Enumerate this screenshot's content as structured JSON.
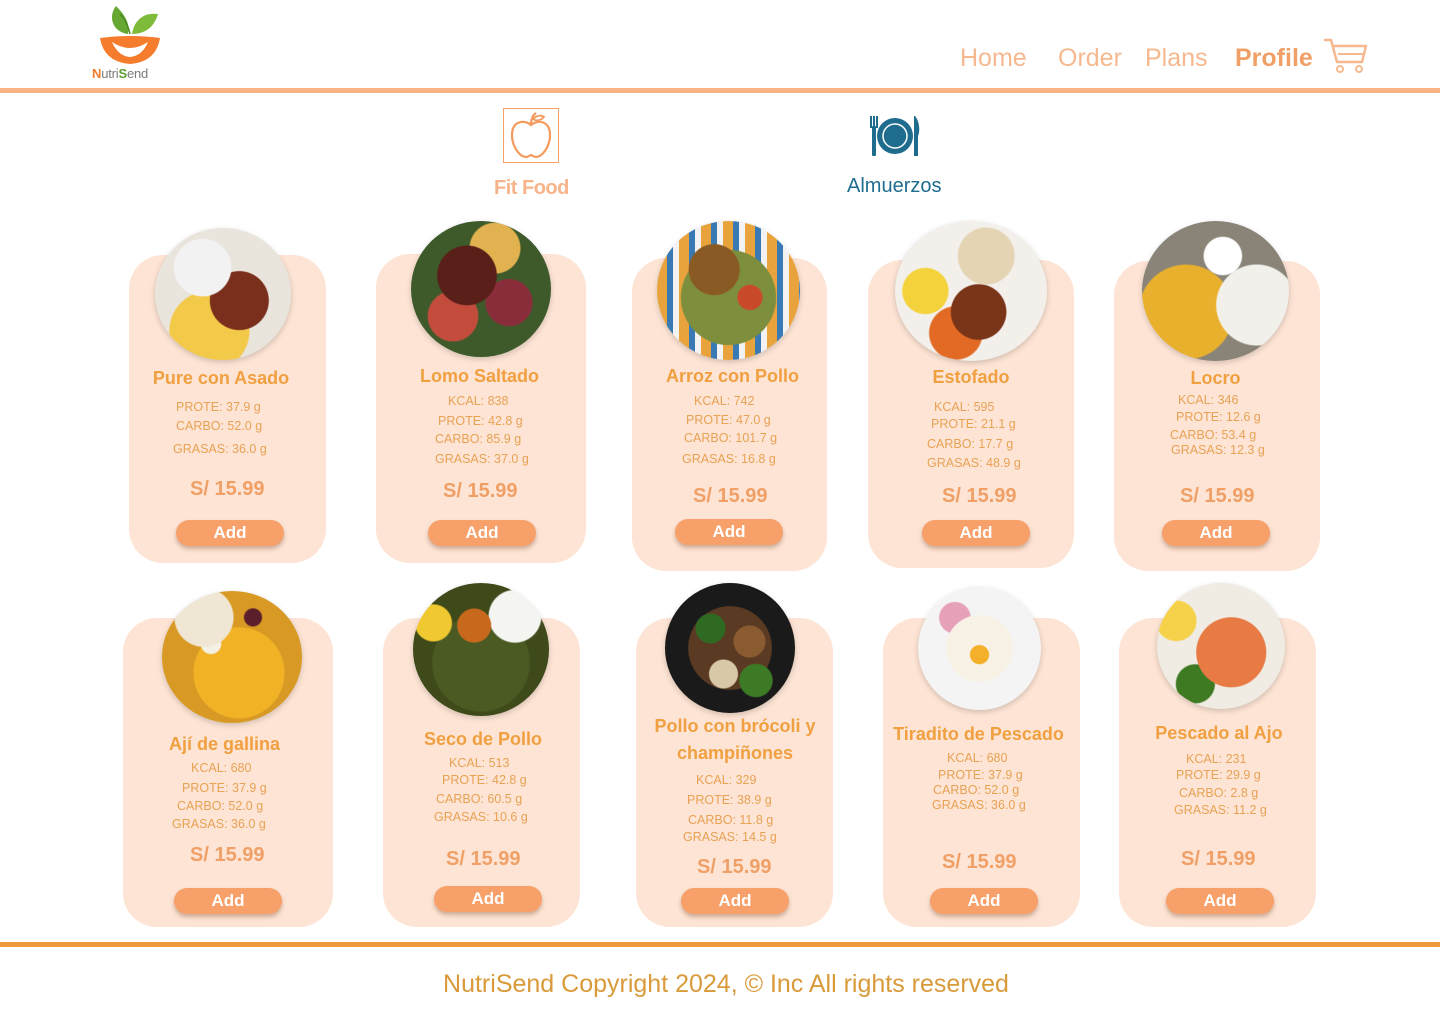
{
  "brand": {
    "name_part1": "N",
    "name_part2": "utri",
    "name_part3": "S",
    "name_part4": "end",
    "accent_color": "#f7a06a",
    "card_color": "#fde4d4"
  },
  "nav": {
    "home": "Home",
    "order": "Order",
    "plans": "Plans",
    "profile": "Profile",
    "cart_icon": "cart-icon"
  },
  "categories": {
    "fit_food": "Fit Food",
    "almuerzos": "Almuerzos"
  },
  "dishes": [
    {
      "name": "Pure con Asado",
      "kcal": "",
      "prote": "PROTE: 37.9 g",
      "carbo": "CARBO: 52.0  g",
      "grasas": "GRASAS: 36.0  g",
      "price": "S/ 15.99",
      "add": "Add"
    },
    {
      "name": "Lomo Saltado",
      "kcal": "KCAL: 838",
      "prote": "PROTE: 42.8 g",
      "carbo": "CARBO: 85.9 g",
      "grasas": "GRASAS: 37.0 g",
      "price": "S/ 15.99",
      "add": "Add"
    },
    {
      "name": "Arroz con Pollo",
      "kcal": "KCAL: 742",
      "prote": "PROTE: 47.0 g",
      "carbo": "CARBO: 101.7 g",
      "grasas": "GRASAS: 16.8 g",
      "price": "S/ 15.99",
      "add": "Add"
    },
    {
      "name": "Estofado",
      "kcal": "KCAL: 595",
      "prote": "PROTE: 21.1  g",
      "carbo": "CARBO: 17.7  g",
      "grasas": "GRASAS: 48.9 g",
      "price": "S/ 15.99",
      "add": "Add"
    },
    {
      "name": "Locro",
      "kcal": "KCAL: 346",
      "prote": "PROTE: 12.6 g",
      "carbo": "CARBO: 53.4 g",
      "grasas": "GRASAS: 12.3 g",
      "price": "S/ 15.99",
      "add": "Add"
    },
    {
      "name": "Ají de gallina",
      "kcal": "KCAL: 680",
      "prote": "PROTE: 37.9 g",
      "carbo": "CARBO: 52.0  g",
      "grasas": "GRASAS: 36.0  g",
      "price": "S/ 15.99",
      "add": "Add"
    },
    {
      "name": "Seco de Pollo",
      "kcal": "KCAL: 513",
      "prote": "PROTE: 42.8 g",
      "carbo": "CARBO: 60.5 g",
      "grasas": "GRASAS: 10.6 g",
      "price": "S/ 15.99",
      "add": "Add"
    },
    {
      "name": "Pollo con brócoli y champiñones",
      "kcal": "KCAL: 329",
      "prote": "PROTE: 38.9 g",
      "carbo": "CARBO: 11.8 g",
      "grasas": "GRASAS: 14.5 g",
      "price": "S/ 15.99",
      "add": "Add"
    },
    {
      "name": "Tiradito de Pescado",
      "kcal": "KCAL: 680",
      "prote": "PROTE: 37.9 g",
      "carbo": "CARBO: 52.0  g",
      "grasas": "GRASAS: 36.0  g",
      "price": "S/ 15.99",
      "add": "Add"
    },
    {
      "name": "Pescado al Ajo",
      "kcal": "KCAL: 231",
      "prote": "PROTE: 29.9 g",
      "carbo": "CARBO: 2.8 g",
      "grasas": "GRASAS: 11.2 g",
      "price": "S/ 15.99",
      "add": "Add"
    }
  ],
  "footer": {
    "text": "NutriSend Copyright 2024, © Inc All rights reserved"
  }
}
